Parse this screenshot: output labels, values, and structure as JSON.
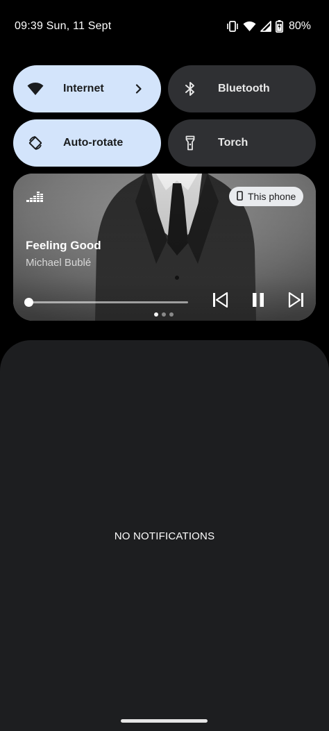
{
  "status_bar": {
    "time_date": "09:39 Sun, 11 Sept",
    "battery": "80%",
    "icons": [
      "vibrate-icon",
      "wifi-icon",
      "signal-icon",
      "battery-icon"
    ]
  },
  "quick_settings": {
    "tiles": [
      {
        "label": "Internet",
        "icon": "wifi-icon",
        "state": "on",
        "has_chevron": true
      },
      {
        "label": "Bluetooth",
        "icon": "bluetooth-icon",
        "state": "off"
      },
      {
        "label": "Auto-rotate",
        "icon": "rotate-icon",
        "state": "on"
      },
      {
        "label": "Torch",
        "icon": "flashlight-icon",
        "state": "off"
      }
    ]
  },
  "media": {
    "output_device": "This phone",
    "title": "Feeling Good",
    "artist": "Michael Bublé",
    "progress": 0.0,
    "controls": [
      "previous-icon",
      "pause-icon",
      "next-icon"
    ],
    "pages": 3,
    "active_page": 1
  },
  "notifications": {
    "empty_message": "NO NOTIFICATIONS"
  },
  "colors": {
    "tile_on": "#d3e4fb",
    "tile_off": "#2f3033",
    "shade": "#1d1e20"
  }
}
